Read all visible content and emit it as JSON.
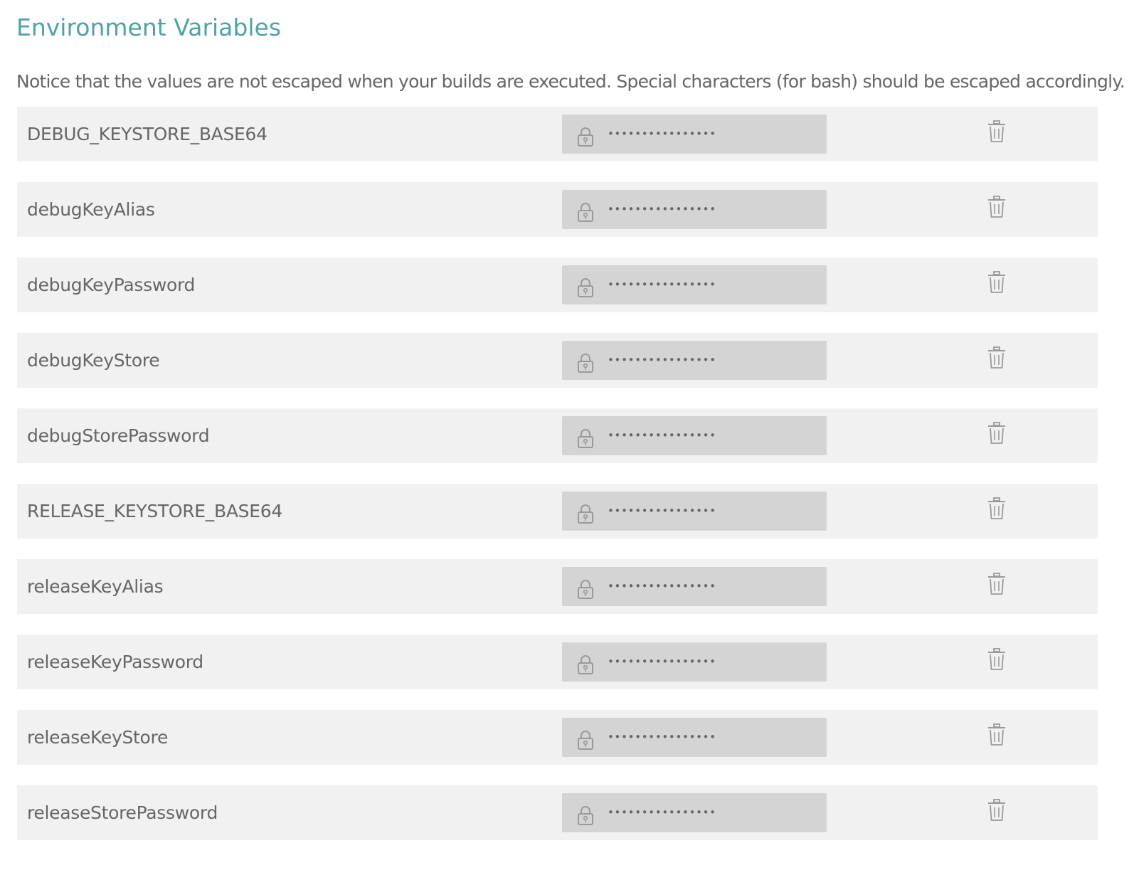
{
  "section": {
    "title": "Environment Variables",
    "notice": "Notice that the values are not escaped when your builds are executed. Special characters (for bash) should be escaped accordingly."
  },
  "variables": [
    {
      "name": "DEBUG_KEYSTORE_BASE64",
      "value_masked": "••••••••••••••••"
    },
    {
      "name": "debugKeyAlias",
      "value_masked": "••••••••••••••••"
    },
    {
      "name": "debugKeyPassword",
      "value_masked": "••••••••••••••••"
    },
    {
      "name": "debugKeyStore",
      "value_masked": "••••••••••••••••"
    },
    {
      "name": "debugStorePassword",
      "value_masked": "••••••••••••••••"
    },
    {
      "name": "RELEASE_KEYSTORE_BASE64",
      "value_masked": "••••••••••••••••"
    },
    {
      "name": "releaseKeyAlias",
      "value_masked": "••••••••••••••••"
    },
    {
      "name": "releaseKeyPassword",
      "value_masked": "••••••••••••••••"
    },
    {
      "name": "releaseKeyStore",
      "value_masked": "••••••••••••••••"
    },
    {
      "name": "releaseStorePassword",
      "value_masked": "••••••••••••••••"
    }
  ],
  "icons": {
    "value_icon": "lock-icon",
    "action_icon": "trash-icon"
  },
  "colors": {
    "title": "#4fa3a8",
    "text": "#666666",
    "row_background": "#f1f1f1",
    "value_background": "#d4d4d4",
    "icon": "#9a9a9a"
  }
}
